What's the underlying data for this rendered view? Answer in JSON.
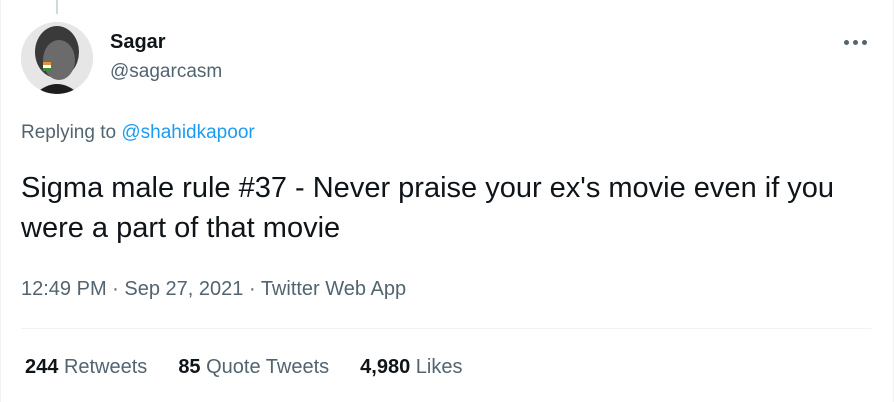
{
  "tweet": {
    "author": {
      "display_name": "Sagar",
      "handle": "@sagarcasm"
    },
    "reply_prefix": "Replying to ",
    "reply_to": "@shahidkapoor",
    "text": "Sigma male rule #37 - Never praise your ex's movie even if you were a part of that movie",
    "time": "12:49 PM",
    "separator": " · ",
    "date": "Sep 27, 2021",
    "source": "Twitter Web App",
    "stats": {
      "retweets_count": "244",
      "retweets_label": "Retweets",
      "quotes_count": "85",
      "quotes_label": "Quote Tweets",
      "likes_count": "4,980",
      "likes_label": "Likes"
    }
  },
  "icons": {
    "more": "more-horizontal-icon"
  },
  "colors": {
    "accent": "#1d9bf0",
    "text_primary": "#0f1419",
    "text_secondary": "#536471",
    "divider": "#eff3f4"
  }
}
